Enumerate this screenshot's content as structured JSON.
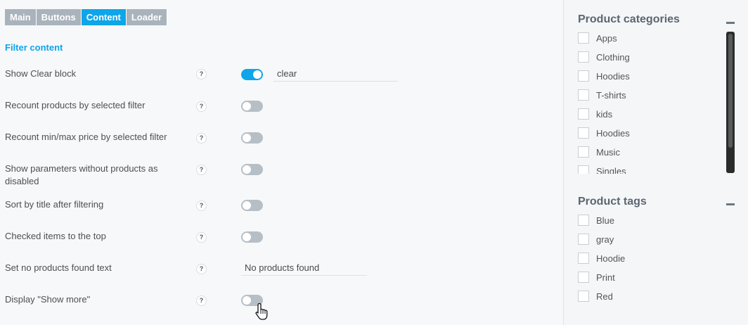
{
  "tabs": [
    {
      "label": "Main",
      "active": false
    },
    {
      "label": "Buttons",
      "active": false
    },
    {
      "label": "Content",
      "active": true
    },
    {
      "label": "Loader",
      "active": false
    }
  ],
  "section_title": "Filter content",
  "help_glyph": "?",
  "settings": {
    "show_clear_block": {
      "label": "Show Clear block",
      "enabled": true,
      "value": "clear"
    },
    "recount_products": {
      "label": "Recount products by selected filter",
      "enabled": false
    },
    "recount_price": {
      "label": "Recount min/max price by selected filter",
      "enabled": false
    },
    "show_params_disabled": {
      "label": "Show parameters without products as disabled",
      "enabled": false
    },
    "sort_by_title": {
      "label": "Sort by title after filtering",
      "enabled": false
    },
    "checked_to_top": {
      "label": "Checked items to the top",
      "enabled": false
    },
    "no_products_text": {
      "label": "Set no products found text",
      "value": "No products found"
    },
    "display_show_more": {
      "label": "Display \"Show more\"",
      "enabled": false
    }
  },
  "sidebar": {
    "categories": {
      "title": "Product categories",
      "items": [
        "Apps",
        "Clothing",
        "Hoodies",
        "T-shirts",
        "kids",
        "Hoodies",
        "Music",
        "Singles"
      ]
    },
    "tags": {
      "title": "Product tags",
      "items": [
        "Blue",
        "gray",
        "Hoodie",
        "Print",
        "Red"
      ]
    }
  },
  "colors": {
    "accent": "#0ea5e9",
    "tab_inactive": "#a9b3bc",
    "toggle_off": "#b7bfc6",
    "scrollbar": "#2b2b2b"
  }
}
